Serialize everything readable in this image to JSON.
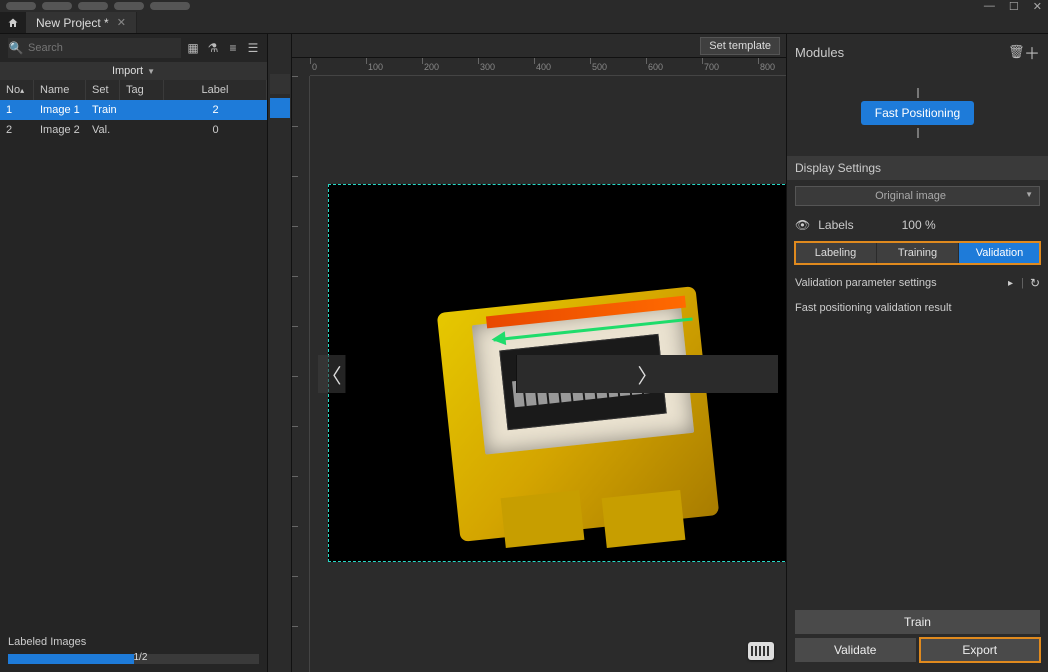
{
  "window": {
    "min": "—",
    "max": "☐",
    "close": "✕"
  },
  "tab": {
    "title": "New Project *"
  },
  "left": {
    "search_placeholder": "Search",
    "import_label": "Import",
    "columns": {
      "no": "No",
      "name": "Name",
      "set": "Set",
      "tag": "Tag",
      "label": "Label"
    },
    "rows": [
      {
        "no": "1",
        "name": "Image 1",
        "set": "Train",
        "tag": "",
        "label": "2",
        "selected": true
      },
      {
        "no": "2",
        "name": "Image 2",
        "set": "Val.",
        "tag": "",
        "label": "0",
        "selected": false
      }
    ],
    "labeled_title": "Labeled Images",
    "labeled_progress_text": "1/2",
    "labeled_progress_pct": 50
  },
  "center": {
    "set_template_label": "Set template",
    "ruler_ticks": [
      "0",
      "100",
      "200",
      "300",
      "400",
      "500",
      "600",
      "700",
      "800"
    ]
  },
  "right": {
    "modules_title": "Modules",
    "module_chip": "Fast Positioning",
    "display_settings_title": "Display Settings",
    "image_mode": "Original image",
    "labels_label": "Labels",
    "labels_pct": "100 %",
    "tabs": {
      "labeling": "Labeling",
      "training": "Training",
      "validation": "Validation"
    },
    "vp_settings": "Validation parameter settings",
    "vp_result": "Fast positioning validation result",
    "train_btn": "Train",
    "validate_btn": "Validate",
    "export_btn": "Export"
  }
}
